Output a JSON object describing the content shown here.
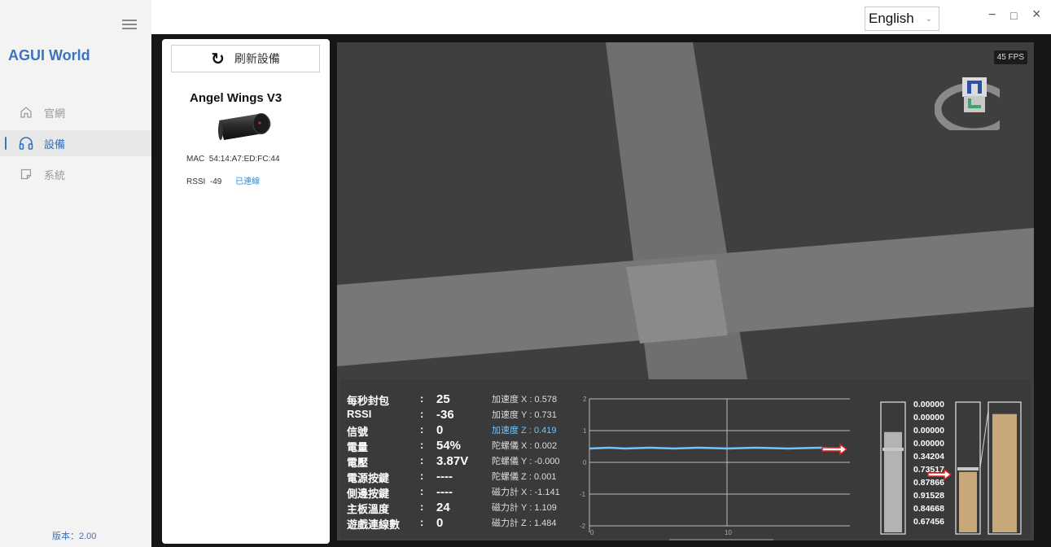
{
  "sidebar": {
    "app_title": "AGUI World",
    "items": [
      {
        "label": "官網",
        "icon": "home-icon"
      },
      {
        "label": "設備",
        "icon": "headphones-icon"
      },
      {
        "label": "系統",
        "icon": "note-icon"
      }
    ],
    "version": "版本：2.00"
  },
  "topbar": {
    "language": "English",
    "minimize": "−",
    "maximize": "□",
    "close": "×"
  },
  "device_panel": {
    "refresh_label": "刷新設備",
    "device_name": "Angel Wings V3",
    "mac_label": "MAC",
    "mac_value": "54:14:A7:ED:FC:44",
    "rssi_label": "RSSI",
    "rssi_value": "-49",
    "status": "已連線"
  },
  "viewport": {
    "fps": "45 FPS"
  },
  "stats": [
    {
      "label": "每秒封包",
      "colon": ":",
      "value": "25"
    },
    {
      "label": "RSSI",
      "colon": ":",
      "value": "-36"
    },
    {
      "label": "信號",
      "colon": ":",
      "value": "0"
    },
    {
      "label": "電量",
      "colon": ":",
      "value": "54%"
    },
    {
      "label": "電壓",
      "colon": ":",
      "value": "3.87V"
    },
    {
      "label": "電源按鍵",
      "colon": ":",
      "value": "----"
    },
    {
      "label": "側邊按鍵",
      "colon": ":",
      "value": "----"
    },
    {
      "label": "主板溫度",
      "colon": ":",
      "value": "24"
    },
    {
      "label": "遊戲連線數",
      "colon": ":",
      "value": "0"
    }
  ],
  "sensors": [
    "加速度 X : 0.578",
    "加速度 Y : 0.731",
    "加速度 Z : 0.419",
    "陀螺儀 X : 0.002",
    "陀螺儀 Y : -0.000",
    "陀螺儀 Z : 0.001",
    "磁力計 X : -1.141",
    "磁力計 Y : 1.109",
    "磁力計 Z : 1.484"
  ],
  "chart": {
    "y_ticks": [
      "2",
      "1",
      "0",
      "-1",
      "-2"
    ],
    "x_ticks": [
      "0",
      "10"
    ]
  },
  "bar_values": [
    "0.00000",
    "0.00000",
    "0.00000",
    "0.00000",
    "0.34204",
    "0.73517",
    "0.87866",
    "0.91528",
    "0.84668",
    "0.67456"
  ],
  "levels": {
    "left_bar": 0.78,
    "mid_bar": 0.47,
    "right_bar": 0.92
  },
  "colors": {
    "accent": "#3a74c2",
    "signal_line": "#70c4ff",
    "bar_fill": "#c8a87a",
    "arrow": "#e02020"
  }
}
